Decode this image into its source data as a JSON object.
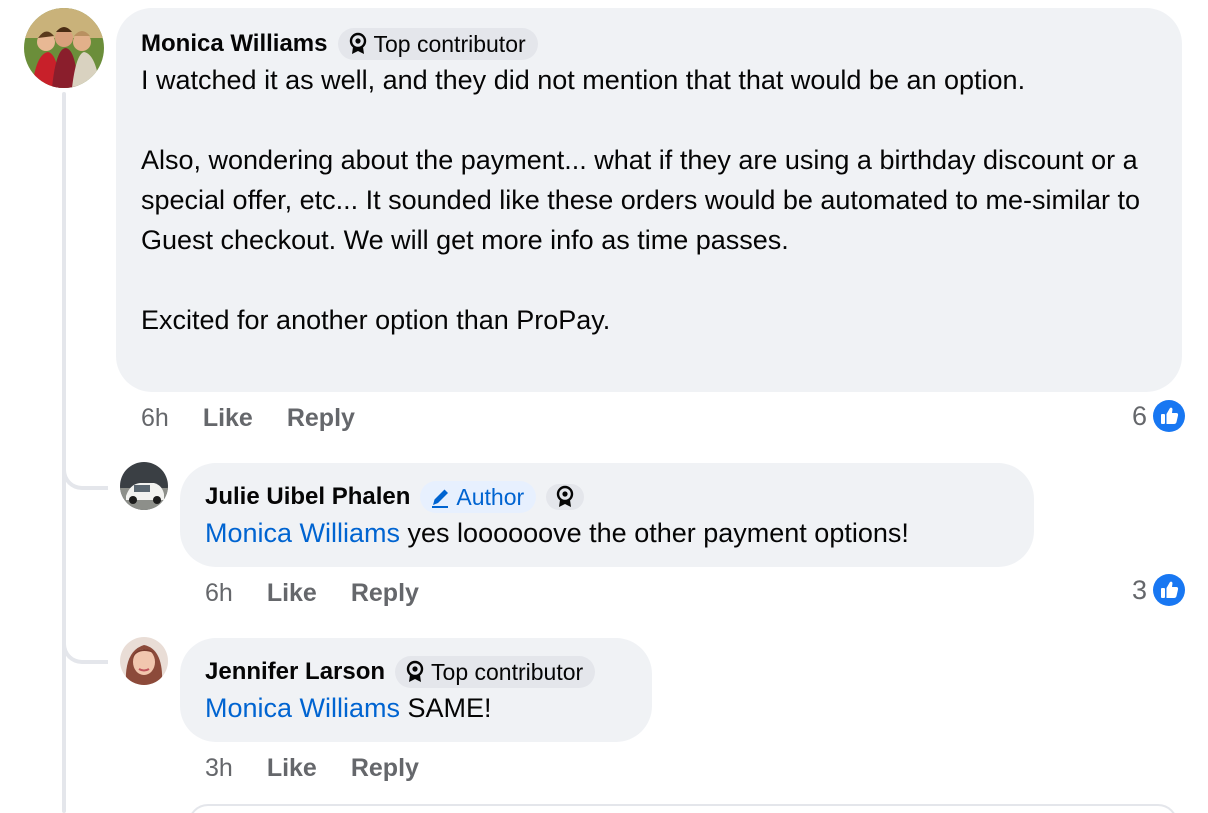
{
  "comments": [
    {
      "author": "Monica Williams",
      "badge": "Top contributor",
      "body": "I watched it as well, and they did not mention that that would be an option.\n\nAlso, wondering about the payment... what if they are using a birthday discount or a special offer, etc... It sounded like these orders would be automated to me-similar to Guest checkout. We will get more info as time passes.\n\nExcited for another option than ProPay.",
      "time": "6h",
      "like_label": "Like",
      "reply_label": "Reply",
      "reactions": "6"
    },
    {
      "author": "Julie Uibel Phalen",
      "badge": "Author",
      "mention": "Monica Williams",
      "body": " yes loooooove the other payment options!",
      "time": "6h",
      "like_label": "Like",
      "reply_label": "Reply",
      "reactions": "3"
    },
    {
      "author": "Jennifer Larson",
      "badge": "Top contributor",
      "mention": "Monica Williams",
      "body": " SAME!",
      "time": "3h",
      "like_label": "Like",
      "reply_label": "Reply"
    }
  ],
  "icons": {
    "badge": "award-ribbon-icon",
    "author_badge": "pencil-icon",
    "reaction": "like-thumb-icon"
  },
  "colors": {
    "bubble": "#f0f2f5",
    "mention": "#0064d1",
    "like_blue": "#1877f2",
    "muted": "#65676b"
  }
}
